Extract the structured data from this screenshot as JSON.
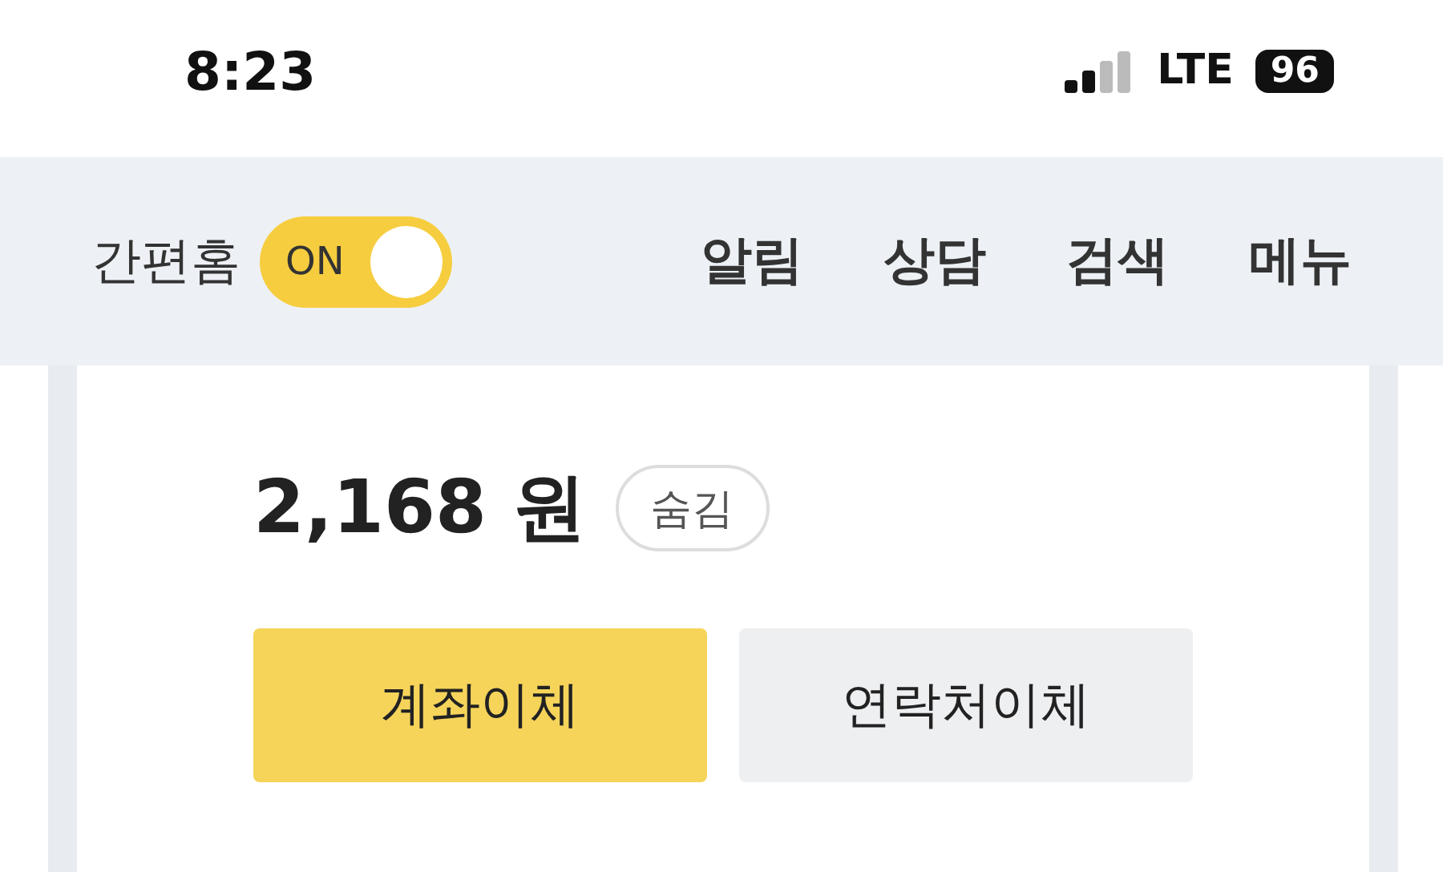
{
  "status_bar": {
    "time": "8:23",
    "network": "LTE",
    "battery": "96"
  },
  "header": {
    "title": "간편홈",
    "toggle": {
      "label": "ON",
      "on": true
    },
    "nav": [
      {
        "label": "알림"
      },
      {
        "label": "상담"
      },
      {
        "label": "검색"
      },
      {
        "label": "메뉴"
      }
    ]
  },
  "balance": {
    "amount": "2,168",
    "unit": "원",
    "hide_button": "숨김"
  },
  "buttons": [
    {
      "label": "계좌이체",
      "kind": "primary"
    },
    {
      "label": "연락처이체",
      "kind": "secondary"
    }
  ]
}
